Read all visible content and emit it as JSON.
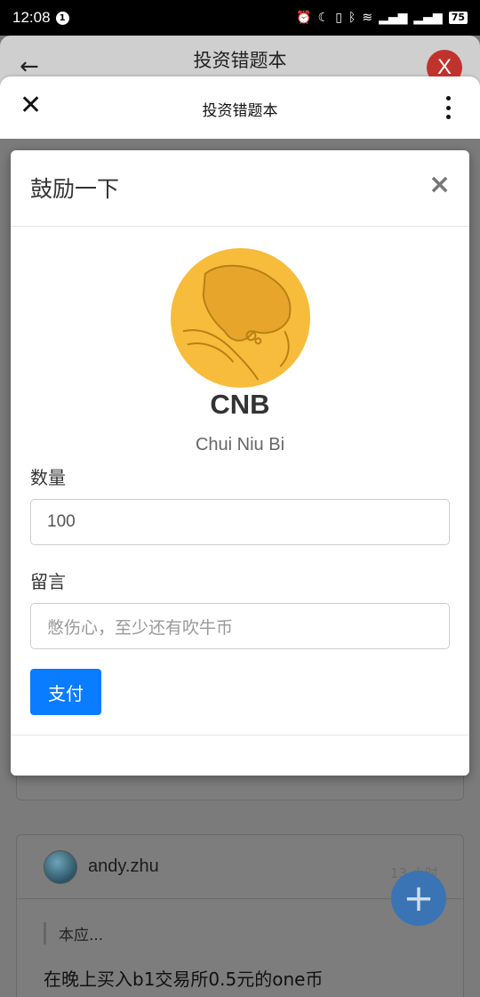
{
  "status_bar": {
    "time": "12:08",
    "notification_count": "1",
    "battery": "75"
  },
  "app_header": {
    "title": "投资错题本",
    "close_label": "X"
  },
  "webview_bar": {
    "title": "投资错题本"
  },
  "modal": {
    "title": "鼓励一下",
    "close_symbol": "×",
    "coin_symbol": "CNB",
    "coin_full_name": "Chui Niu Bi",
    "quantity_label": "数量",
    "quantity_value": "100",
    "message_label": "留言",
    "message_placeholder": "憋伤心，至少还有吹牛币",
    "pay_button": "支付"
  },
  "post": {
    "author": "andy.zhu",
    "time": "13 小时",
    "quote": "本应...",
    "body": "在晚上买入b1交易所0.5元的one币"
  },
  "fab": {
    "symbol": "+"
  },
  "colors": {
    "primary_button": "#0a7cff",
    "close_badge": "#c0332c",
    "coin": "#f7bc3c"
  }
}
